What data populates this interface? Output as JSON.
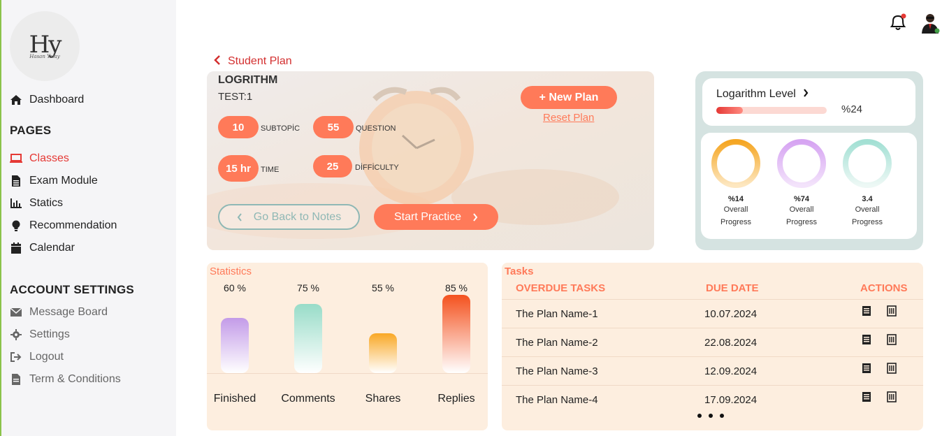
{
  "sidebar": {
    "logo_mark": "Hy",
    "logo_sub": "Hasan Yalay",
    "dashboard": "Dashboard",
    "pages_title": "PAGES",
    "pages": [
      "Classes",
      "Exam Module",
      "Statics",
      "Recommendation",
      "Calendar"
    ],
    "account_title": "ACCOUNT SETTINGS",
    "account": [
      "Message Board",
      "Settings",
      "Logout",
      "Term & Conditions"
    ]
  },
  "colors": {
    "accent": "#ff7a59",
    "active": "#e53935",
    "sidebar_bg": "#f5f5f7",
    "card_bg": "#fdeedf",
    "notification_dot": "#e53935",
    "online_dot": "#43a047"
  },
  "breadcrumb": {
    "back_label": "Student Plan"
  },
  "plan": {
    "title": "LOGRITHM",
    "test": "TEST:1",
    "stats": [
      {
        "value": "10",
        "label": "SUBTOPİC"
      },
      {
        "value": "55",
        "label": "QUESTION"
      },
      {
        "value": "15 hr",
        "label": "TIME"
      },
      {
        "value": "25",
        "label": "DİFFİCULTY"
      }
    ],
    "new_plan": "+ New Plan",
    "reset_plan": "Reset Plan",
    "back_notes": "Go Back to Notes",
    "start_practice": "Start Practice"
  },
  "level": {
    "title": "Logarithm Level",
    "percent_text": "%24",
    "progress": 0.24,
    "rings": [
      {
        "value": "%14",
        "label_1": "Overall",
        "label_2": "Progress",
        "color": "#f5a623"
      },
      {
        "value": "%74",
        "label_1": "Overall",
        "label_2": "Progress",
        "color": "#d6a4f2"
      },
      {
        "value": "3.4",
        "label_1": "Overall",
        "label_2": "Progress",
        "color": "#a3e0d4"
      }
    ]
  },
  "statistics": {
    "title": "Statistics",
    "bars": [
      {
        "category": "Finished",
        "pct_text": "60 %",
        "value": 60,
        "top": "#c39be8",
        "bottom": "#ffffff"
      },
      {
        "category": "Comments",
        "pct_text": "75 %",
        "value": 75,
        "top": "#98dcc8",
        "bottom": "#ffffff"
      },
      {
        "category": "Shares",
        "pct_text": "55 %",
        "value": 55,
        "top": "#f9a826",
        "bottom": "#ffffff"
      },
      {
        "category": "Replies",
        "pct_text": "85 %",
        "value": 85,
        "top": "#f4511e",
        "bottom": "#ffffff"
      }
    ]
  },
  "tasks": {
    "title": "Tasks",
    "headers": {
      "name": "OVERDUE TASKS",
      "date": "DUE DATE",
      "actions": "ACTIONS"
    },
    "rows": [
      {
        "name": "The Plan Name-1",
        "date": "10.07.2024"
      },
      {
        "name": "The Plan Name-2",
        "date": "22.08.2024"
      },
      {
        "name": "The Plan Name-3",
        "date": "12.09.2024"
      },
      {
        "name": "The Plan Name-4",
        "date": "17.09.2024"
      }
    ]
  }
}
